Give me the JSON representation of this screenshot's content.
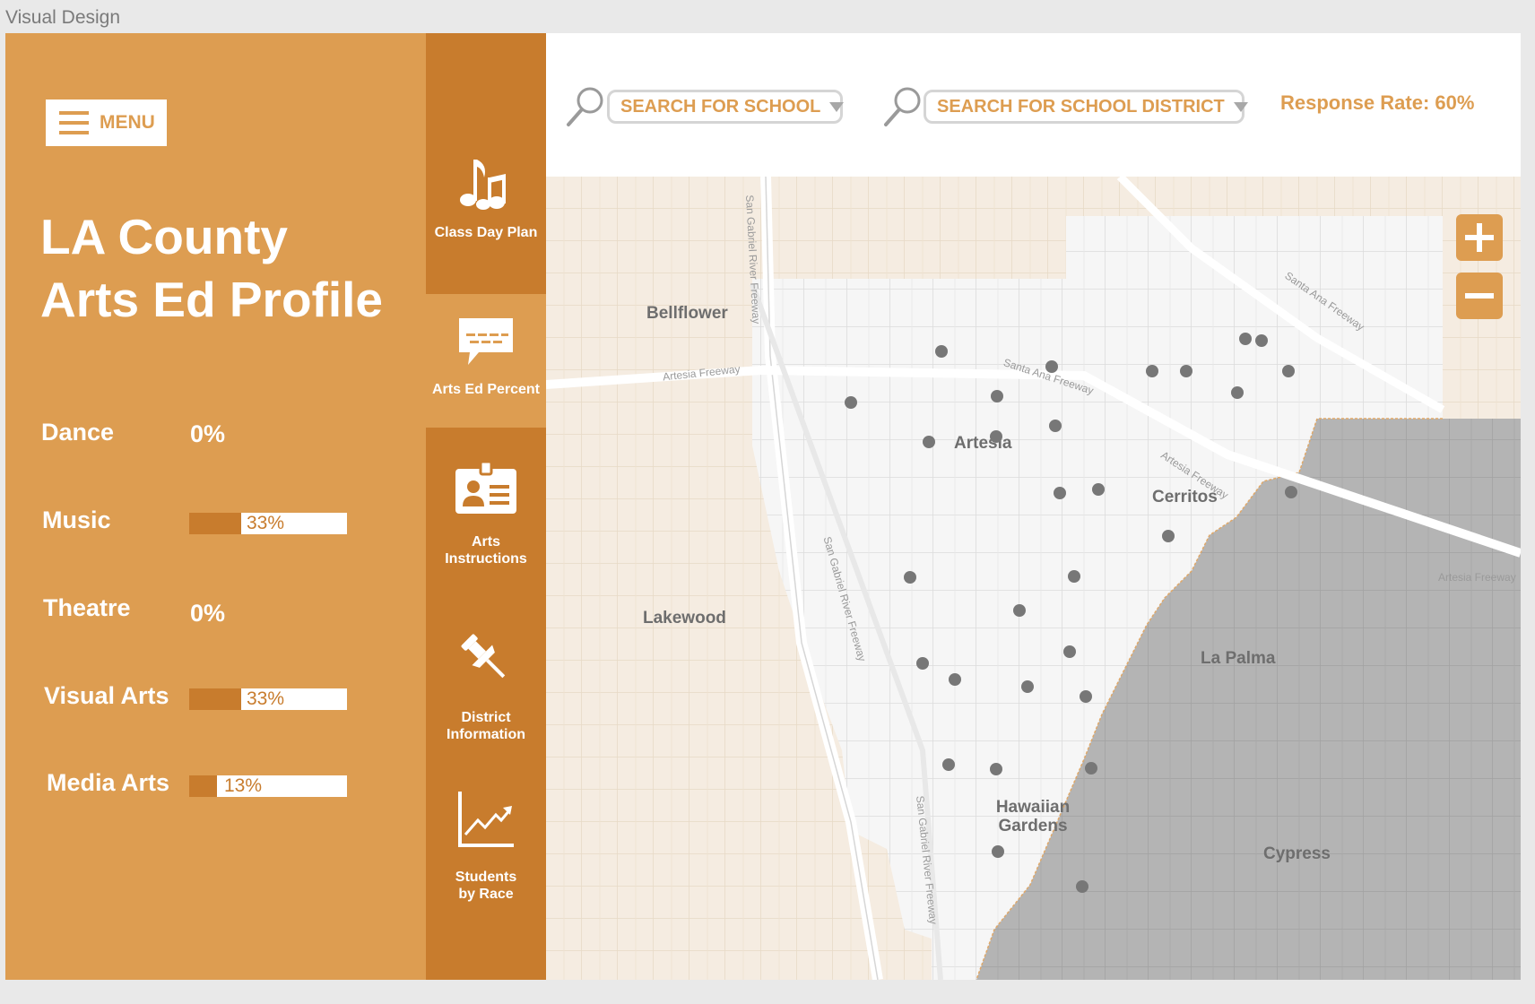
{
  "window_title": "Visual Design",
  "colors": {
    "panel": "#dd9d51",
    "nav": "#c87c2d",
    "accent_dark": "#c87c2d",
    "map_tan": "#f5ece1",
    "map_light": "#f4f4f4",
    "map_gray": "#b5b5b5"
  },
  "sidebar": {
    "menu_label": "MENU",
    "title_line1": "LA County",
    "title_line2": "Arts Ed Profile",
    "stats": [
      {
        "label": "Dance",
        "value": "0%",
        "percent": 0
      },
      {
        "label": "Music",
        "value": "33%",
        "percent": 33
      },
      {
        "label": "Theatre",
        "value": "0%",
        "percent": 0
      },
      {
        "label": "Visual Arts",
        "value": "33%",
        "percent": 33
      },
      {
        "label": "Media Arts",
        "value": "13%",
        "percent": 13
      }
    ]
  },
  "nav": {
    "items": [
      {
        "label": "Class Day Plan",
        "icon": "music-notes-icon"
      },
      {
        "label": "Arts Ed Percent",
        "icon": "speech-bubble-icon"
      },
      {
        "label": "Arts Instructions",
        "icon": "id-card-icon"
      },
      {
        "label": "District Information",
        "icon": "pushpin-icon"
      },
      {
        "label": "Students by Race",
        "icon": "line-chart-icon"
      }
    ],
    "active_index": 1
  },
  "header": {
    "school_search": "SEARCH FOR SCHOOL",
    "district_search": "SEARCH FOR SCHOOL DISTRICT",
    "response_rate": "Response Rate: 60%"
  },
  "map": {
    "places": [
      "Bellflower",
      "Artesia",
      "Cerritos",
      "Lakewood",
      "La Palma",
      "Hawaiian Gardens",
      "Cypress"
    ],
    "roads": [
      "San Gabriel River Freeway",
      "Artesia Freeway",
      "Santa Ana Freeway",
      "Artesia Freeway",
      "Artesia Freeway",
      "Santa Ana Freeway",
      "San Gabriel River Freeway",
      "San Gabriel River Freeway"
    ],
    "zoom_in": "+",
    "zoom_out": "−"
  }
}
